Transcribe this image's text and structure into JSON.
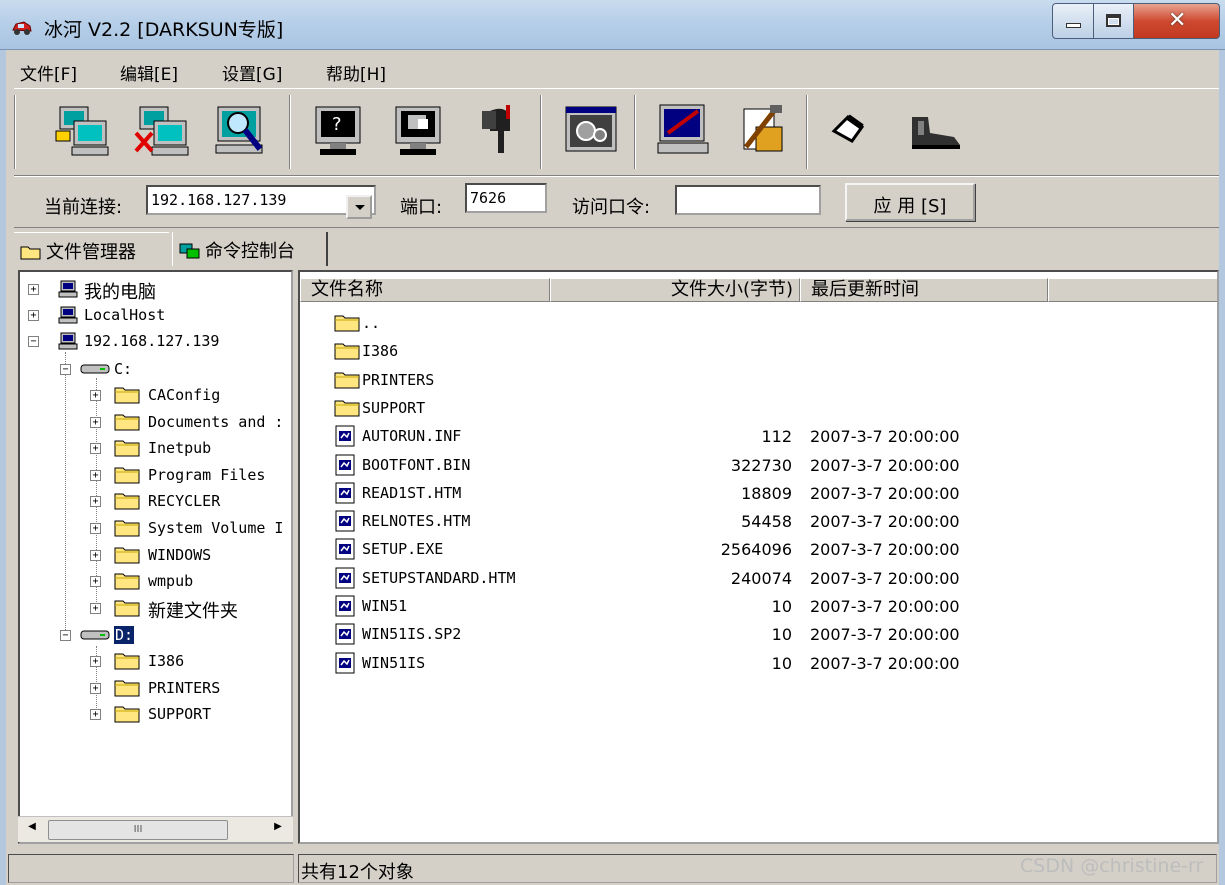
{
  "window": {
    "title": "冰河 V2.2 [DARKSUN专版]"
  },
  "menu": [
    "文件[F]",
    "编辑[E]",
    "设置[G]",
    "帮助[H]"
  ],
  "toolbar_icons": [
    "add-host-icon",
    "delete-host-icon",
    "search-host-icon",
    "screen-capture-icon",
    "screen-control-icon",
    "mail-info-icon",
    "settings-gear-icon",
    "edit-config-icon",
    "tools-icon",
    "upgrade-icon",
    "shoe-exit-icon"
  ],
  "connection": {
    "current_label": "当前连接:",
    "current_value": "192.168.127.139",
    "port_label": "端口:",
    "port_value": "7626",
    "password_label": "访问口令:",
    "password_value": "",
    "apply_label": "应 用 [S]"
  },
  "tabs": [
    "文件管理器",
    "命令控制台"
  ],
  "tree": {
    "my_computer": "我的电脑",
    "localhost": "LocalHost",
    "remote": "192.168.127.139",
    "drive_c": "C:",
    "c_folders": [
      "CAConfig",
      "Documents and :",
      "Inetpub",
      "Program Files",
      "RECYCLER",
      "System Volume I",
      "WINDOWS",
      "wmpub",
      "新建文件夹"
    ],
    "drive_d": "D:",
    "d_folders": [
      "I386",
      "PRINTERS",
      "SUPPORT"
    ],
    "scroll_thumb": "III"
  },
  "list": {
    "columns": [
      "文件名称",
      "文件大小(字节)",
      "最后更新时间"
    ],
    "rows": [
      {
        "name": "..",
        "type": "folder",
        "size": "",
        "date": ""
      },
      {
        "name": "I386",
        "type": "folder",
        "size": "",
        "date": ""
      },
      {
        "name": "PRINTERS",
        "type": "folder",
        "size": "",
        "date": ""
      },
      {
        "name": "SUPPORT",
        "type": "folder",
        "size": "",
        "date": ""
      },
      {
        "name": "AUTORUN.INF",
        "type": "file",
        "size": "112",
        "date": "2007-3-7 20:00:00"
      },
      {
        "name": "BOOTFONT.BIN",
        "type": "file",
        "size": "322730",
        "date": "2007-3-7 20:00:00"
      },
      {
        "name": "READ1ST.HTM",
        "type": "file",
        "size": "18809",
        "date": "2007-3-7 20:00:00"
      },
      {
        "name": "RELNOTES.HTM",
        "type": "file",
        "size": "54458",
        "date": "2007-3-7 20:00:00"
      },
      {
        "name": "SETUP.EXE",
        "type": "file",
        "size": "2564096",
        "date": "2007-3-7 20:00:00"
      },
      {
        "name": "SETUPSTANDARD.HTM",
        "type": "file",
        "size": "240074",
        "date": "2007-3-7 20:00:00"
      },
      {
        "name": "WIN51",
        "type": "file",
        "size": "10",
        "date": "2007-3-7 20:00:00"
      },
      {
        "name": "WIN51IS.SP2",
        "type": "file",
        "size": "10",
        "date": "2007-3-7 20:00:00"
      },
      {
        "name": "WIN51IS",
        "type": "file",
        "size": "10",
        "date": "2007-3-7 20:00:00"
      }
    ]
  },
  "status": {
    "left": "",
    "right": "共有12个对象"
  },
  "watermark": "CSDN @christine-rr"
}
